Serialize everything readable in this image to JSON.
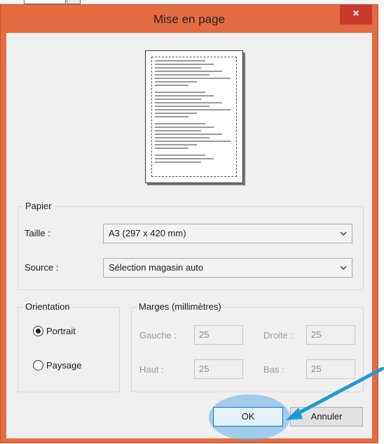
{
  "window": {
    "title": "Mise en page",
    "close_glyph": "×"
  },
  "paper": {
    "group_label": "Papier",
    "size_label": "Taille :",
    "size_value": "A3 (297 x 420 mm)",
    "source_label": "Source :",
    "source_value": "Sélection magasin auto"
  },
  "orientation": {
    "group_label": "Orientation",
    "portrait_label": "Portrait",
    "landscape_label": "Paysage",
    "selected": "Portrait"
  },
  "margins": {
    "group_label": "Marges (millimètres)",
    "left_label": "Gauche :",
    "left_value": "25",
    "right_label": "Droite :",
    "right_value": "25",
    "top_label": "Haut :",
    "top_value": "25",
    "bottom_label": "Bas :",
    "bottom_value": "25"
  },
  "buttons": {
    "ok_label": "OK",
    "cancel_label": "Annuler"
  },
  "colors": {
    "title_bar": "#e56c41",
    "close_button": "#c8392b",
    "highlight": "#60b0e6",
    "arrow": "#1e9ad6"
  },
  "icons": {
    "close": "close-icon",
    "dropdown": "chevron-down-icon"
  }
}
